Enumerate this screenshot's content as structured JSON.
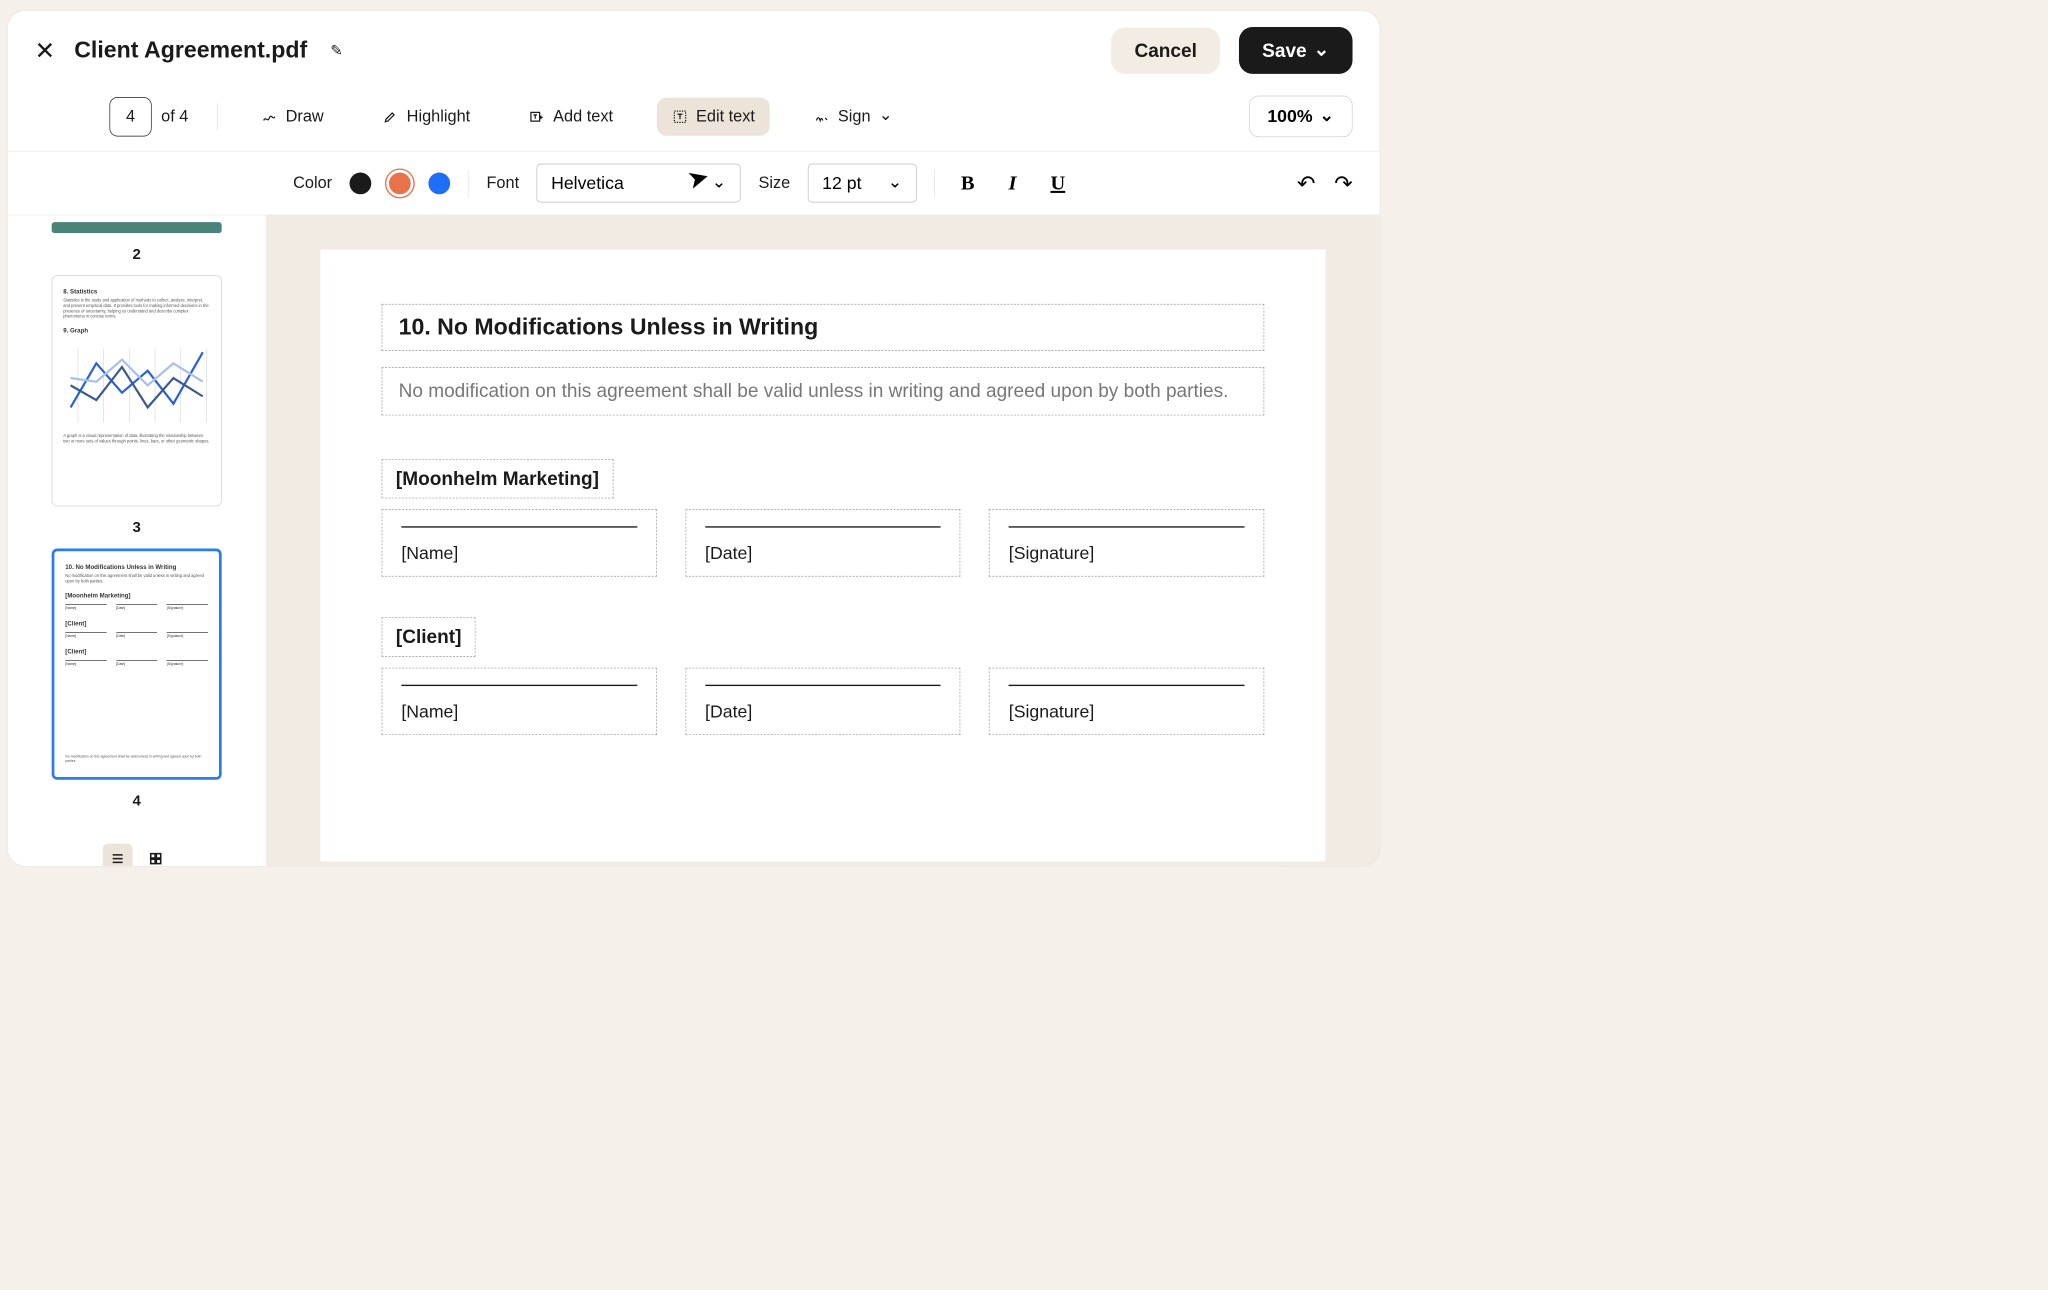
{
  "header": {
    "title": "Client Agreement.pdf",
    "cancel_label": "Cancel",
    "save_label": "Save"
  },
  "toolbar": {
    "current_page": "4",
    "total_pages_label": "of 4",
    "draw_label": "Draw",
    "highlight_label": "Highlight",
    "add_text_label": "Add text",
    "edit_text_label": "Edit text",
    "sign_label": "Sign",
    "zoom_label": "100%"
  },
  "format_bar": {
    "color_label": "Color",
    "font_label": "Font",
    "font_value": "Helvetica",
    "size_label": "Size",
    "size_value": "12 pt",
    "colors": {
      "black": "#1a1a1a",
      "orange": "#e8724a",
      "blue": "#1e6ff5"
    }
  },
  "sidebar": {
    "thumbnails": [
      {
        "page_number": "2"
      },
      {
        "page_number": "3",
        "heading_a": "8. Statistics",
        "body_a": "Statistics is the study and application of methods to collect, analyze, interpret, and present empirical data. It provides tools for making informed decisions in the presence of uncertainty, helping us understand and describe complex phenomena in concise terms.",
        "heading_b": "9. Graph",
        "body_b": "A graph is a visual representation of data, illustrating the relationship between two or more sets of values through points, lines, bars, or other geometric shapes."
      },
      {
        "page_number": "4",
        "heading": "10. No Modifications Unless in Writing",
        "body": "No modification on this agreement shall be valid unless in writing and agreed upon by both parties.",
        "party_a": "[Moonhelm Marketing]",
        "party_b": "[Client]",
        "fields": [
          "[Name]",
          "[Date]",
          "[Signature]"
        ],
        "footer": "No modification on this agreement shall be valid unless in writing and agreed upon by both parties."
      }
    ]
  },
  "document": {
    "section_heading": "10. No Modifications Unless in Writing",
    "section_body": "No modification on this agreement shall be valid unless in writing and agreed upon by both parties.",
    "signatories": [
      {
        "label": "[Moonhelm Marketing]",
        "fields": [
          "[Name]",
          "[Date]",
          "[Signature]"
        ]
      },
      {
        "label": "[Client]",
        "fields": [
          "[Name]",
          "[Date]",
          "[Signature]"
        ]
      }
    ]
  }
}
